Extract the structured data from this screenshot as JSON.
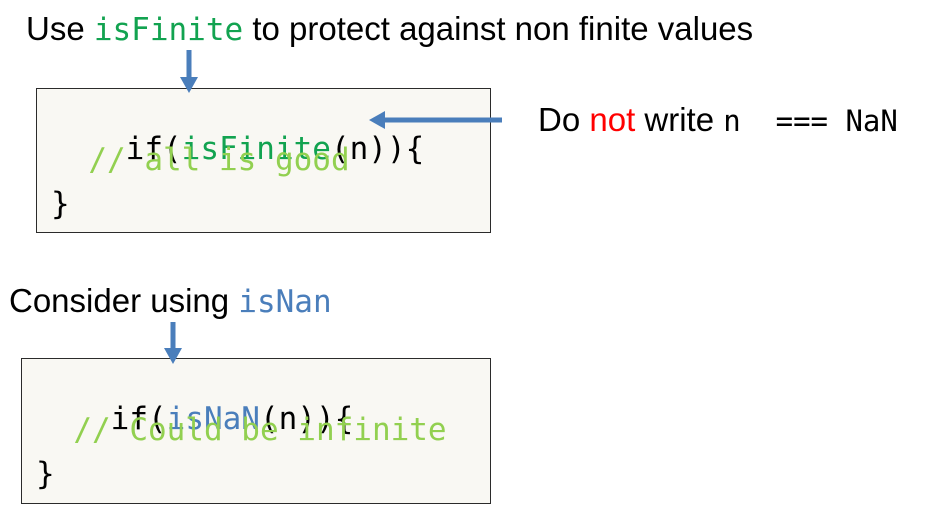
{
  "top_note": {
    "prefix": "Use ",
    "keyword": "isFinite",
    "suffix": " to protect against non finite values"
  },
  "box1": {
    "line1": {
      "pre": "if(",
      "kw": "isFinite",
      "post": "(n)){"
    },
    "line2": "  // all is good",
    "line3": "}"
  },
  "side_note": {
    "prefix": "Do ",
    "emph": "not",
    "middle": " write ",
    "code": "n  === NaN"
  },
  "mid_note": {
    "prefix": "Consider using ",
    "keyword": "isNan"
  },
  "box2": {
    "line1": {
      "pre": "if(",
      "kw": "isNaN",
      "post": "(n)){"
    },
    "line2": "  // Could be infinite",
    "line3": "}"
  },
  "colors": {
    "green_keyword": "#12a350",
    "blue_keyword": "#4a7ebb",
    "comment": "#92d050",
    "emphasis": "#ff0000",
    "arrow": "#4a7ebb",
    "box_fill": "#f9f8f3"
  }
}
